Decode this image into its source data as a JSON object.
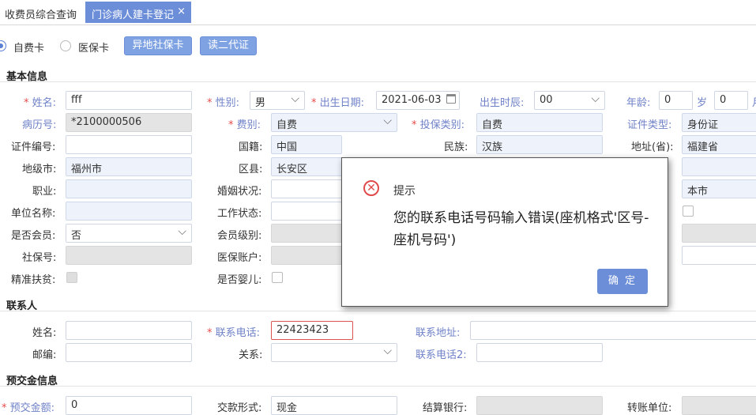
{
  "tabs": {
    "tab1": "收费员综合查询",
    "tab2": "门诊病人建卡登记",
    "close": "×"
  },
  "card_row": {
    "radio1": "自费卡",
    "radio2": "医保卡",
    "btn_remote": "异地社保卡",
    "btn_id": "读二代证"
  },
  "basic": {
    "section_title": "基本信息",
    "star": "*",
    "name_label": "姓名:",
    "name_value": "fff",
    "gender_label": "性别:",
    "gender_value": "男",
    "dob_label": "出生日期:",
    "dob_value": "2021-06-03",
    "birth_hour_label": "出生时辰:",
    "birth_hour_value": "00",
    "age_label": "年龄:",
    "age_value": "0",
    "age_unit_sui": "岁",
    "age_month_value": "0",
    "age_unit_yue": "月",
    "record_no_label": "病历号:",
    "record_no_value": "*2100000506",
    "fee_type_label": "费别:",
    "fee_type_value": "自费",
    "insure_type_label": "投保类别:",
    "insure_type_value": "自费",
    "id_type_label": "证件类型:",
    "id_type_value": "身份证",
    "id_no_label": "证件编号:",
    "nationality_label": "国籍:",
    "nationality_value": "中国",
    "ethnicity_label": "民族:",
    "ethnicity_value": "汉族",
    "province_label": "地址(省):",
    "province_value": "福建省",
    "city_label": "地级市:",
    "city_value": "福州市",
    "district_label": "区县:",
    "district_value": "长安区",
    "local_value": "本市",
    "occupation_label": "职业:",
    "marital_label": "婚姻状况:",
    "employer_label": "单位名称:",
    "work_status_label": "工作状态:",
    "member_label": "是否会员:",
    "member_value": "否",
    "member_level_label": "会员级别:",
    "social_no_label": "社保号:",
    "insure_account_label": "医保账户:",
    "poverty_label": "精准扶贫:",
    "infant_label": "是否婴儿:"
  },
  "contact": {
    "section_title": "联系人",
    "name_label": "姓名:",
    "phone_label": "联系电话:",
    "phone_value": "22423423",
    "address_label": "联系地址:",
    "zip_label": "邮编:",
    "relation_label": "关系:",
    "phone2_label": "联系电话2:"
  },
  "prepay": {
    "section_title": "预交金信息",
    "amount_label": "预交金额:",
    "amount_value": "0",
    "pay_form_label": "交款形式:",
    "pay_form_value": "现金",
    "bank_label": "结算银行:",
    "transfer_unit_label": "转账单位:"
  },
  "dialog": {
    "title": "提示",
    "message": "您的联系电话号码输入错误(座机格式'区号-座机号码')",
    "ok": "确 定"
  }
}
